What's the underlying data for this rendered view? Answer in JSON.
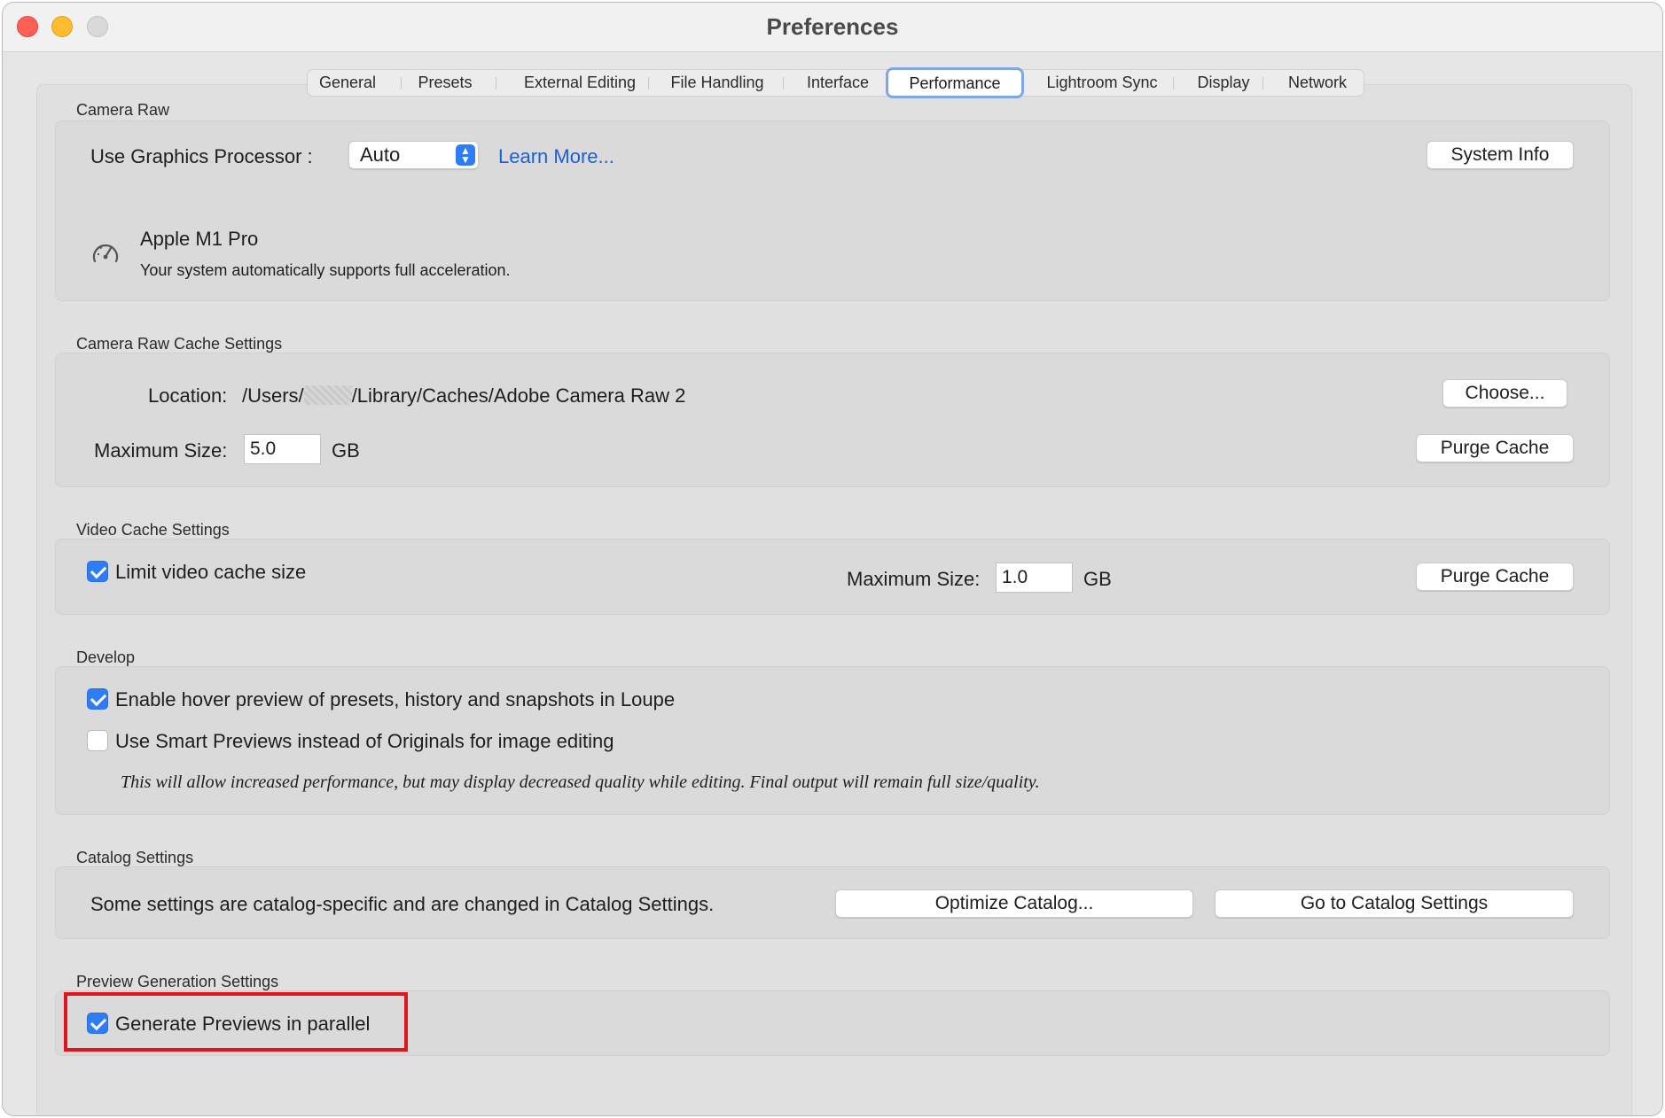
{
  "window": {
    "title": "Preferences"
  },
  "tabs": [
    {
      "label": "General",
      "active": false
    },
    {
      "label": "Presets",
      "active": false
    },
    {
      "label": "External Editing",
      "active": false
    },
    {
      "label": "File Handling",
      "active": false
    },
    {
      "label": "Interface",
      "active": false
    },
    {
      "label": "Performance",
      "active": true
    },
    {
      "label": "Lightroom Sync",
      "active": false
    },
    {
      "label": "Display",
      "active": false
    },
    {
      "label": "Network",
      "active": false
    }
  ],
  "camera_raw": {
    "section_label": "Camera Raw",
    "gpu_label": "Use Graphics Processor :",
    "gpu_value": "Auto",
    "learn_more": "Learn More...",
    "system_info_button": "System Info",
    "gpu_name": "Apple M1 Pro",
    "gpu_status": "Your system automatically supports full acceleration."
  },
  "cache": {
    "section_label": "Camera Raw Cache Settings",
    "location_label": "Location:",
    "location_prefix": "/Users/",
    "location_suffix": "/Library/Caches/Adobe Camera Raw 2",
    "choose_button": "Choose...",
    "max_size_label": "Maximum Size:",
    "max_size_value": "5.0",
    "unit": "GB",
    "purge_button": "Purge Cache"
  },
  "video_cache": {
    "section_label": "Video Cache Settings",
    "limit_label": "Limit video cache size",
    "limit_checked": true,
    "max_size_label": "Maximum Size:",
    "max_size_value": "1.0",
    "unit": "GB",
    "purge_button": "Purge Cache"
  },
  "develop": {
    "section_label": "Develop",
    "hover_label": "Enable hover preview of presets, history and snapshots in Loupe",
    "hover_checked": true,
    "smart_label": "Use Smart Previews instead of Originals for image editing",
    "smart_checked": false,
    "note": "This will allow increased performance, but may display decreased quality while editing. Final output will remain full size/quality."
  },
  "catalog": {
    "section_label": "Catalog Settings",
    "description": "Some settings are catalog-specific and are changed in Catalog Settings.",
    "optimize_button": "Optimize Catalog...",
    "goto_button": "Go to Catalog Settings"
  },
  "preview": {
    "section_label": "Preview Generation Settings",
    "parallel_label": "Generate Previews in parallel",
    "parallel_checked": true
  },
  "colors": {
    "accent": "#2f7df6",
    "link": "#1c5fd8",
    "highlight": "#e0141b"
  }
}
